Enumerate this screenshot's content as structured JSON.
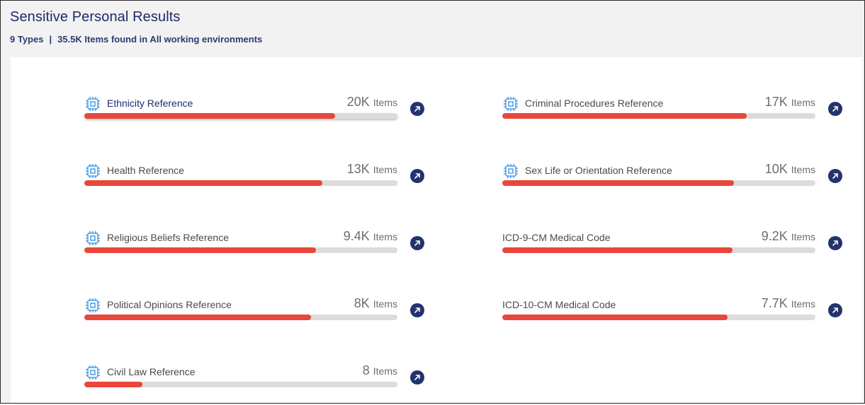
{
  "header": {
    "title": "Sensitive Personal Results",
    "types": "9 Types",
    "separator": "|",
    "summary": "35.5K Items found in All working environments"
  },
  "colors": {
    "accent": "#e8473a",
    "track": "#dcdcdc",
    "button": "#23336e",
    "icon": "#2f8fe0"
  },
  "items": [
    {
      "label": "Ethnicity Reference",
      "count": "20K",
      "unit": "Items",
      "fill": 0.8,
      "icon": "chip-icon"
    },
    {
      "label": "Criminal Procedures Reference",
      "count": "17K",
      "unit": "Items",
      "fill": 0.78,
      "icon": "chip-icon"
    },
    {
      "label": "Health Reference",
      "count": "13K",
      "unit": "Items",
      "fill": 0.76,
      "icon": "chip-icon"
    },
    {
      "label": "Sex Life or Orientation Reference",
      "count": "10K",
      "unit": "Items",
      "fill": 0.74,
      "icon": "chip-icon"
    },
    {
      "label": "Religious Beliefs Reference",
      "count": "9.4K",
      "unit": "Items",
      "fill": 0.74,
      "icon": "chip-icon"
    },
    {
      "label": "ICD-9-CM Medical Code",
      "count": "9.2K",
      "unit": "Items",
      "fill": 0.735,
      "icon": null
    },
    {
      "label": "Political Opinions Reference",
      "count": "8K",
      "unit": "Items",
      "fill": 0.725,
      "icon": "chip-icon"
    },
    {
      "label": "ICD-10-CM Medical Code",
      "count": "7.7K",
      "unit": "Items",
      "fill": 0.72,
      "icon": null
    },
    {
      "label": "Civil Law Reference",
      "count": "8",
      "unit": "Items",
      "fill": 0.185,
      "icon": "chip-icon"
    }
  ]
}
